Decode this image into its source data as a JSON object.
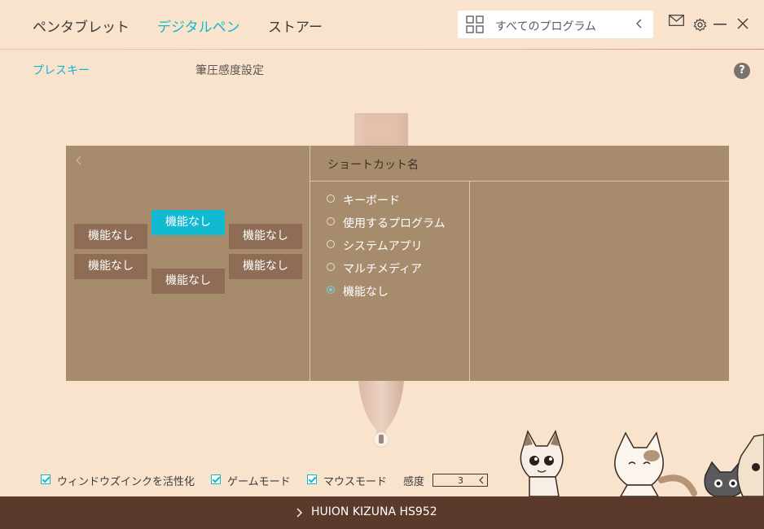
{
  "nav": {
    "tabs": [
      {
        "label": "ペンタブレット"
      },
      {
        "label": "デジタルペン"
      },
      {
        "label": "ストアー"
      }
    ],
    "search_placeholder": "すべてのプログラム"
  },
  "subtabs": {
    "press_key": "プレスキー",
    "pressure": "筆圧感度設定"
  },
  "help": "?",
  "dialog": {
    "shortcut_title": "ショートカット名",
    "function_buttons": [
      "機能なし",
      "機能なし",
      "機能なし",
      "機能なし",
      "機能なし",
      "機能なし"
    ],
    "options": [
      {
        "label": "キーボード"
      },
      {
        "label": "使用するプログラム"
      },
      {
        "label": "システムアプリ"
      },
      {
        "label": "マルチメディア"
      },
      {
        "label": "機能なし"
      }
    ],
    "selected_option": "機能なし"
  },
  "settings": {
    "windows_ink": "ウィンドウズインクを活性化",
    "game_mode": "ゲームモード",
    "mouse_mode": "マウスモード",
    "sensitivity_label": "感度",
    "sensitivity_value": "3"
  },
  "footer": {
    "device": "HUION KIZUNA HS952"
  },
  "colors": {
    "accent": "#12b9cc",
    "background": "#fae3cd",
    "panel": "#a78b6d",
    "footer": "#5a3a2b"
  }
}
